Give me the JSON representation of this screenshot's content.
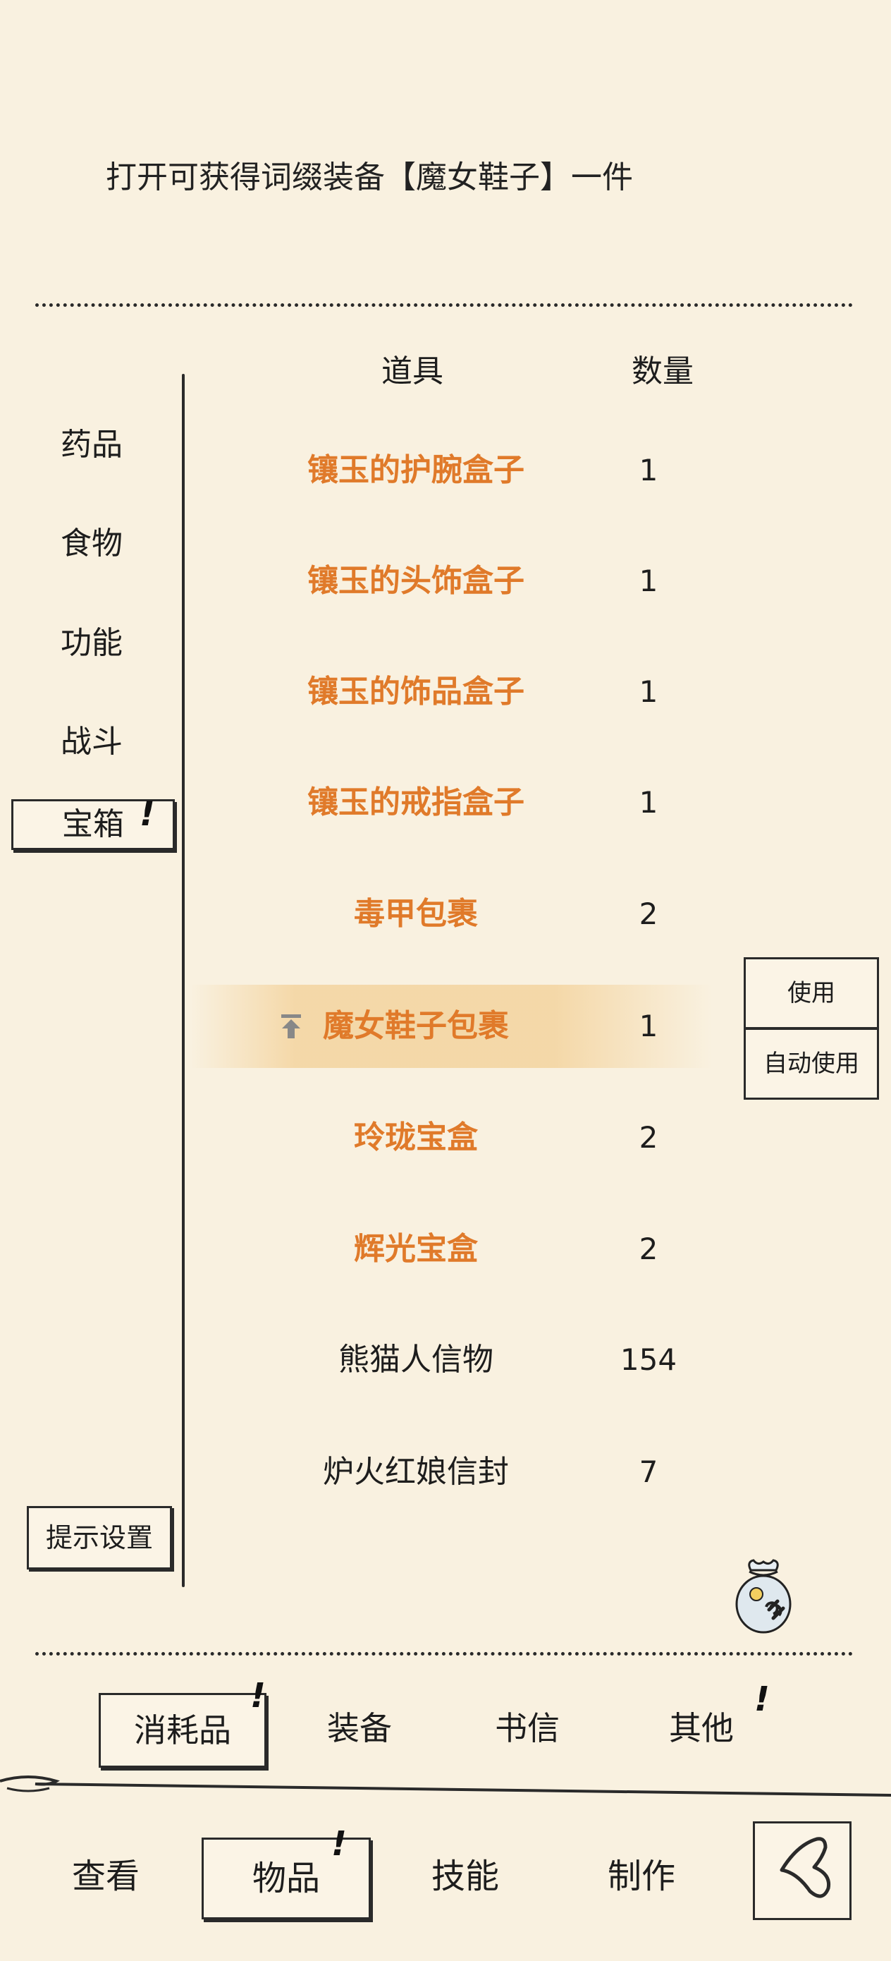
{
  "description": "打开可获得词缀装备【魔女鞋子】一件",
  "columns": {
    "item": "道具",
    "qty": "数量"
  },
  "categories": [
    "药品",
    "食物",
    "功能",
    "战斗",
    "宝箱"
  ],
  "active_category": "宝箱",
  "items": [
    {
      "name": "镶玉的护腕盒子",
      "qty": "1",
      "color": "orange"
    },
    {
      "name": "镶玉的头饰盒子",
      "qty": "1",
      "color": "orange"
    },
    {
      "name": "镶玉的饰品盒子",
      "qty": "1",
      "color": "orange"
    },
    {
      "name": "镶玉的戒指盒子",
      "qty": "1",
      "color": "orange"
    },
    {
      "name": "毒甲包裹",
      "qty": "2",
      "color": "orange"
    },
    {
      "name": "魔女鞋子包裹",
      "qty": "1",
      "color": "orange",
      "selected": true
    },
    {
      "name": "玲珑宝盒",
      "qty": "2",
      "color": "orange"
    },
    {
      "name": "辉光宝盒",
      "qty": "2",
      "color": "orange"
    },
    {
      "name": "熊猫人信物",
      "qty": "154",
      "color": "black"
    },
    {
      "name": "炉火红娘信封",
      "qty": "7",
      "color": "black"
    }
  ],
  "actions": {
    "use": "使用",
    "auto_use": "自动使用"
  },
  "hint_settings": "提示设置",
  "subtabs": [
    "消耗品",
    "装备",
    "书信",
    "其他"
  ],
  "tabs": [
    "查看",
    "物品",
    "技能",
    "制作"
  ],
  "colors": {
    "orange": "#e07a2a",
    "background": "#f9f1e0",
    "ink": "#2a2a2a"
  }
}
